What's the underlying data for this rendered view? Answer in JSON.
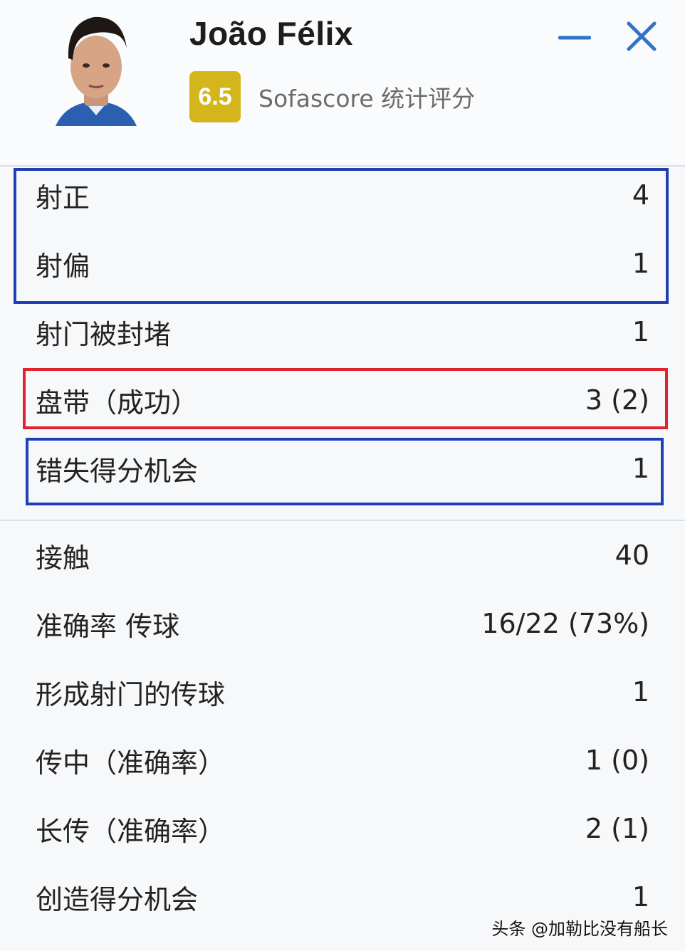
{
  "header": {
    "player_name": "João Félix",
    "rating": "6.5",
    "rating_label": "Sofascore 统计评分",
    "avatar_icon": "player-avatar-icon",
    "minimize_icon": "minimize-icon",
    "close_icon": "close-icon"
  },
  "colors": {
    "rating_badge": "#d4b51b",
    "window_controls": "#2f74c9",
    "highlight_blue": "#1e40b4",
    "highlight_red": "#e0232f"
  },
  "stats_group1": [
    {
      "label": "射正",
      "value": "4"
    },
    {
      "label": "射偏",
      "value": "1"
    },
    {
      "label": "射门被封堵",
      "value": "1"
    },
    {
      "label": "盘带（成功）",
      "value": "3 (2)"
    },
    {
      "label": "错失得分机会",
      "value": "1"
    }
  ],
  "stats_group2": [
    {
      "label": "接触",
      "value": "40"
    },
    {
      "label": "准确率 传球",
      "value": "16/22 (73%)"
    },
    {
      "label": "形成射门的传球",
      "value": "1"
    },
    {
      "label": "传中（准确率）",
      "value": "1 (0)"
    },
    {
      "label": "长传（准确率）",
      "value": "2 (1)"
    },
    {
      "label": "创造得分机会",
      "value": "1"
    }
  ],
  "watermark": "头条 @加勒比没有船长"
}
